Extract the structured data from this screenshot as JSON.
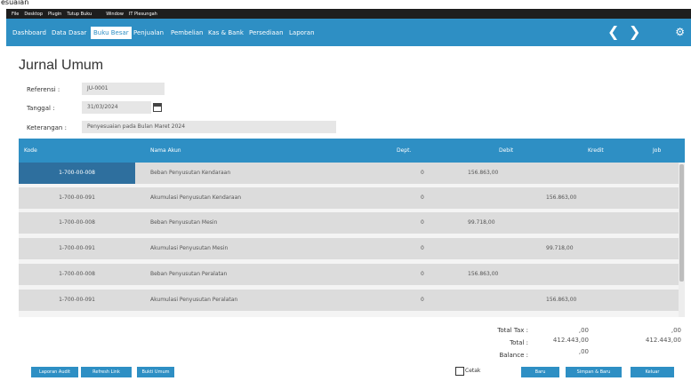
{
  "window": {
    "title": "esuaian"
  },
  "menubar": {
    "items": [
      "File",
      "Desktop",
      "Plugin",
      "Tutup Buku",
      "Window",
      "IT Plesungah"
    ]
  },
  "nav": {
    "tabs": [
      "Dashboard",
      "Data Dasar",
      "Buku Besar",
      "Penjualan",
      "Pembelian",
      "Kas & Bank",
      "Persediaan",
      "Laporan"
    ],
    "active_index": 2,
    "back_glyph": "❮",
    "forward_glyph": "❯",
    "settings_icon": "gear-icon",
    "settings_glyph": "⚙"
  },
  "form": {
    "title": "Jurnal Umum",
    "referensi_label": "Referensi :",
    "referensi_value": "JU-0001",
    "tanggal_label": "Tanggal :",
    "tanggal_value": "31/03/2024",
    "keterangan_label": "Keterangan :",
    "keterangan_value": "Penyesuaian pada Bulan Maret 2024"
  },
  "table": {
    "headers": [
      "Kode",
      "Nama Akun",
      "Dept.",
      "Debit",
      "Kredit",
      "Job"
    ],
    "rows": [
      {
        "kode": "1-700-00-008",
        "nama": "Beban Penyusutan Kendaraan",
        "dept": "0",
        "debit": "156.863,00",
        "kredit": "",
        "selected": true
      },
      {
        "kode": "1-700-00-091",
        "nama": "Akumulasi Penyusutan Kendaraan",
        "dept": "0",
        "debit": "",
        "kredit": "156.863,00",
        "selected": false
      },
      {
        "kode": "1-700-00-008",
        "nama": "Beban Penyusutan Mesin",
        "dept": "0",
        "debit": "99.718,00",
        "kredit": "",
        "selected": false
      },
      {
        "kode": "1-700-00-091",
        "nama": "Akumulasi Penyusutan Mesin",
        "dept": "0",
        "debit": "",
        "kredit": "99.718,00",
        "selected": false
      },
      {
        "kode": "1-700-00-008",
        "nama": "Beban Penyusutan Peralatan",
        "dept": "0",
        "debit": "156.863,00",
        "kredit": "",
        "selected": false
      },
      {
        "kode": "1-700-00-091",
        "nama": "Akumulasi Penyusutan Peralatan",
        "dept": "0",
        "debit": "",
        "kredit": "156.863,00",
        "selected": false
      }
    ]
  },
  "totals": {
    "tax_label": "Total Tax :",
    "tax_debit": ",00",
    "tax_kredit": ",00",
    "total_label": "Total :",
    "total_debit": "412.443,00",
    "total_kredit": "412.443,00",
    "balance_label": "Balance :",
    "balance_value": ",00"
  },
  "footer": {
    "buttons_left": [
      "Laporan Audit",
      "Refresh Link",
      "Bukti Umum"
    ],
    "cetak_label": "Cetak",
    "cetak_checked": false,
    "buttons_right": [
      "Baru",
      "Simpan & Baru",
      "Keluar"
    ]
  },
  "colors": {
    "accent": "#2e8fc4",
    "selected": "#2e6f9e",
    "menubar": "#1e1e1e"
  }
}
